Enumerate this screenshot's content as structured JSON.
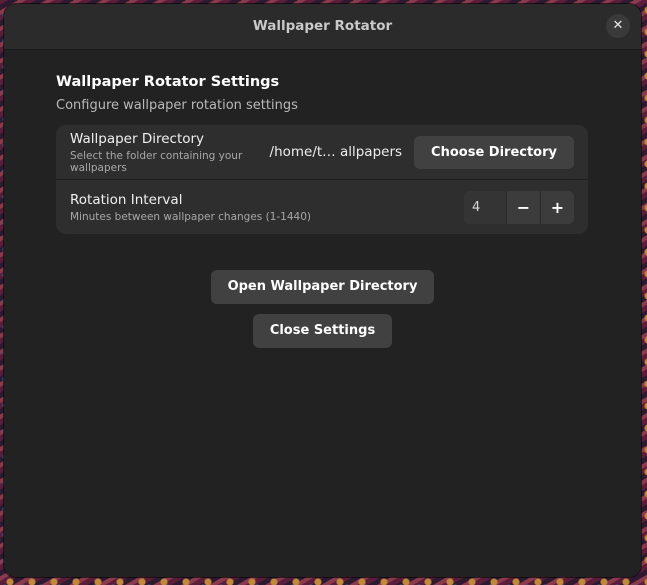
{
  "window": {
    "title": "Wallpaper Rotator",
    "close_glyph": "✕"
  },
  "settings": {
    "title": "Wallpaper Rotator Settings",
    "subtitle": "Configure wallpaper rotation settings",
    "directory": {
      "title": "Wallpaper Directory",
      "description": "Select the folder containing your wallpapers",
      "path": "/home/t… allpapers",
      "button_label": "Choose Directory"
    },
    "interval": {
      "title": "Rotation Interval",
      "description": "Minutes between wallpaper changes (1-1440)",
      "value": "4",
      "decrement": "−",
      "increment": "+"
    }
  },
  "actions": {
    "open_label": "Open Wallpaper Directory",
    "close_label": "Close Settings"
  },
  "colors": {
    "window_bg": "#222222",
    "card_bg": "#2e2e2e",
    "button_bg": "#414141"
  },
  "icons": {
    "close": "close-icon",
    "minus": "minus-icon",
    "plus": "plus-icon"
  }
}
